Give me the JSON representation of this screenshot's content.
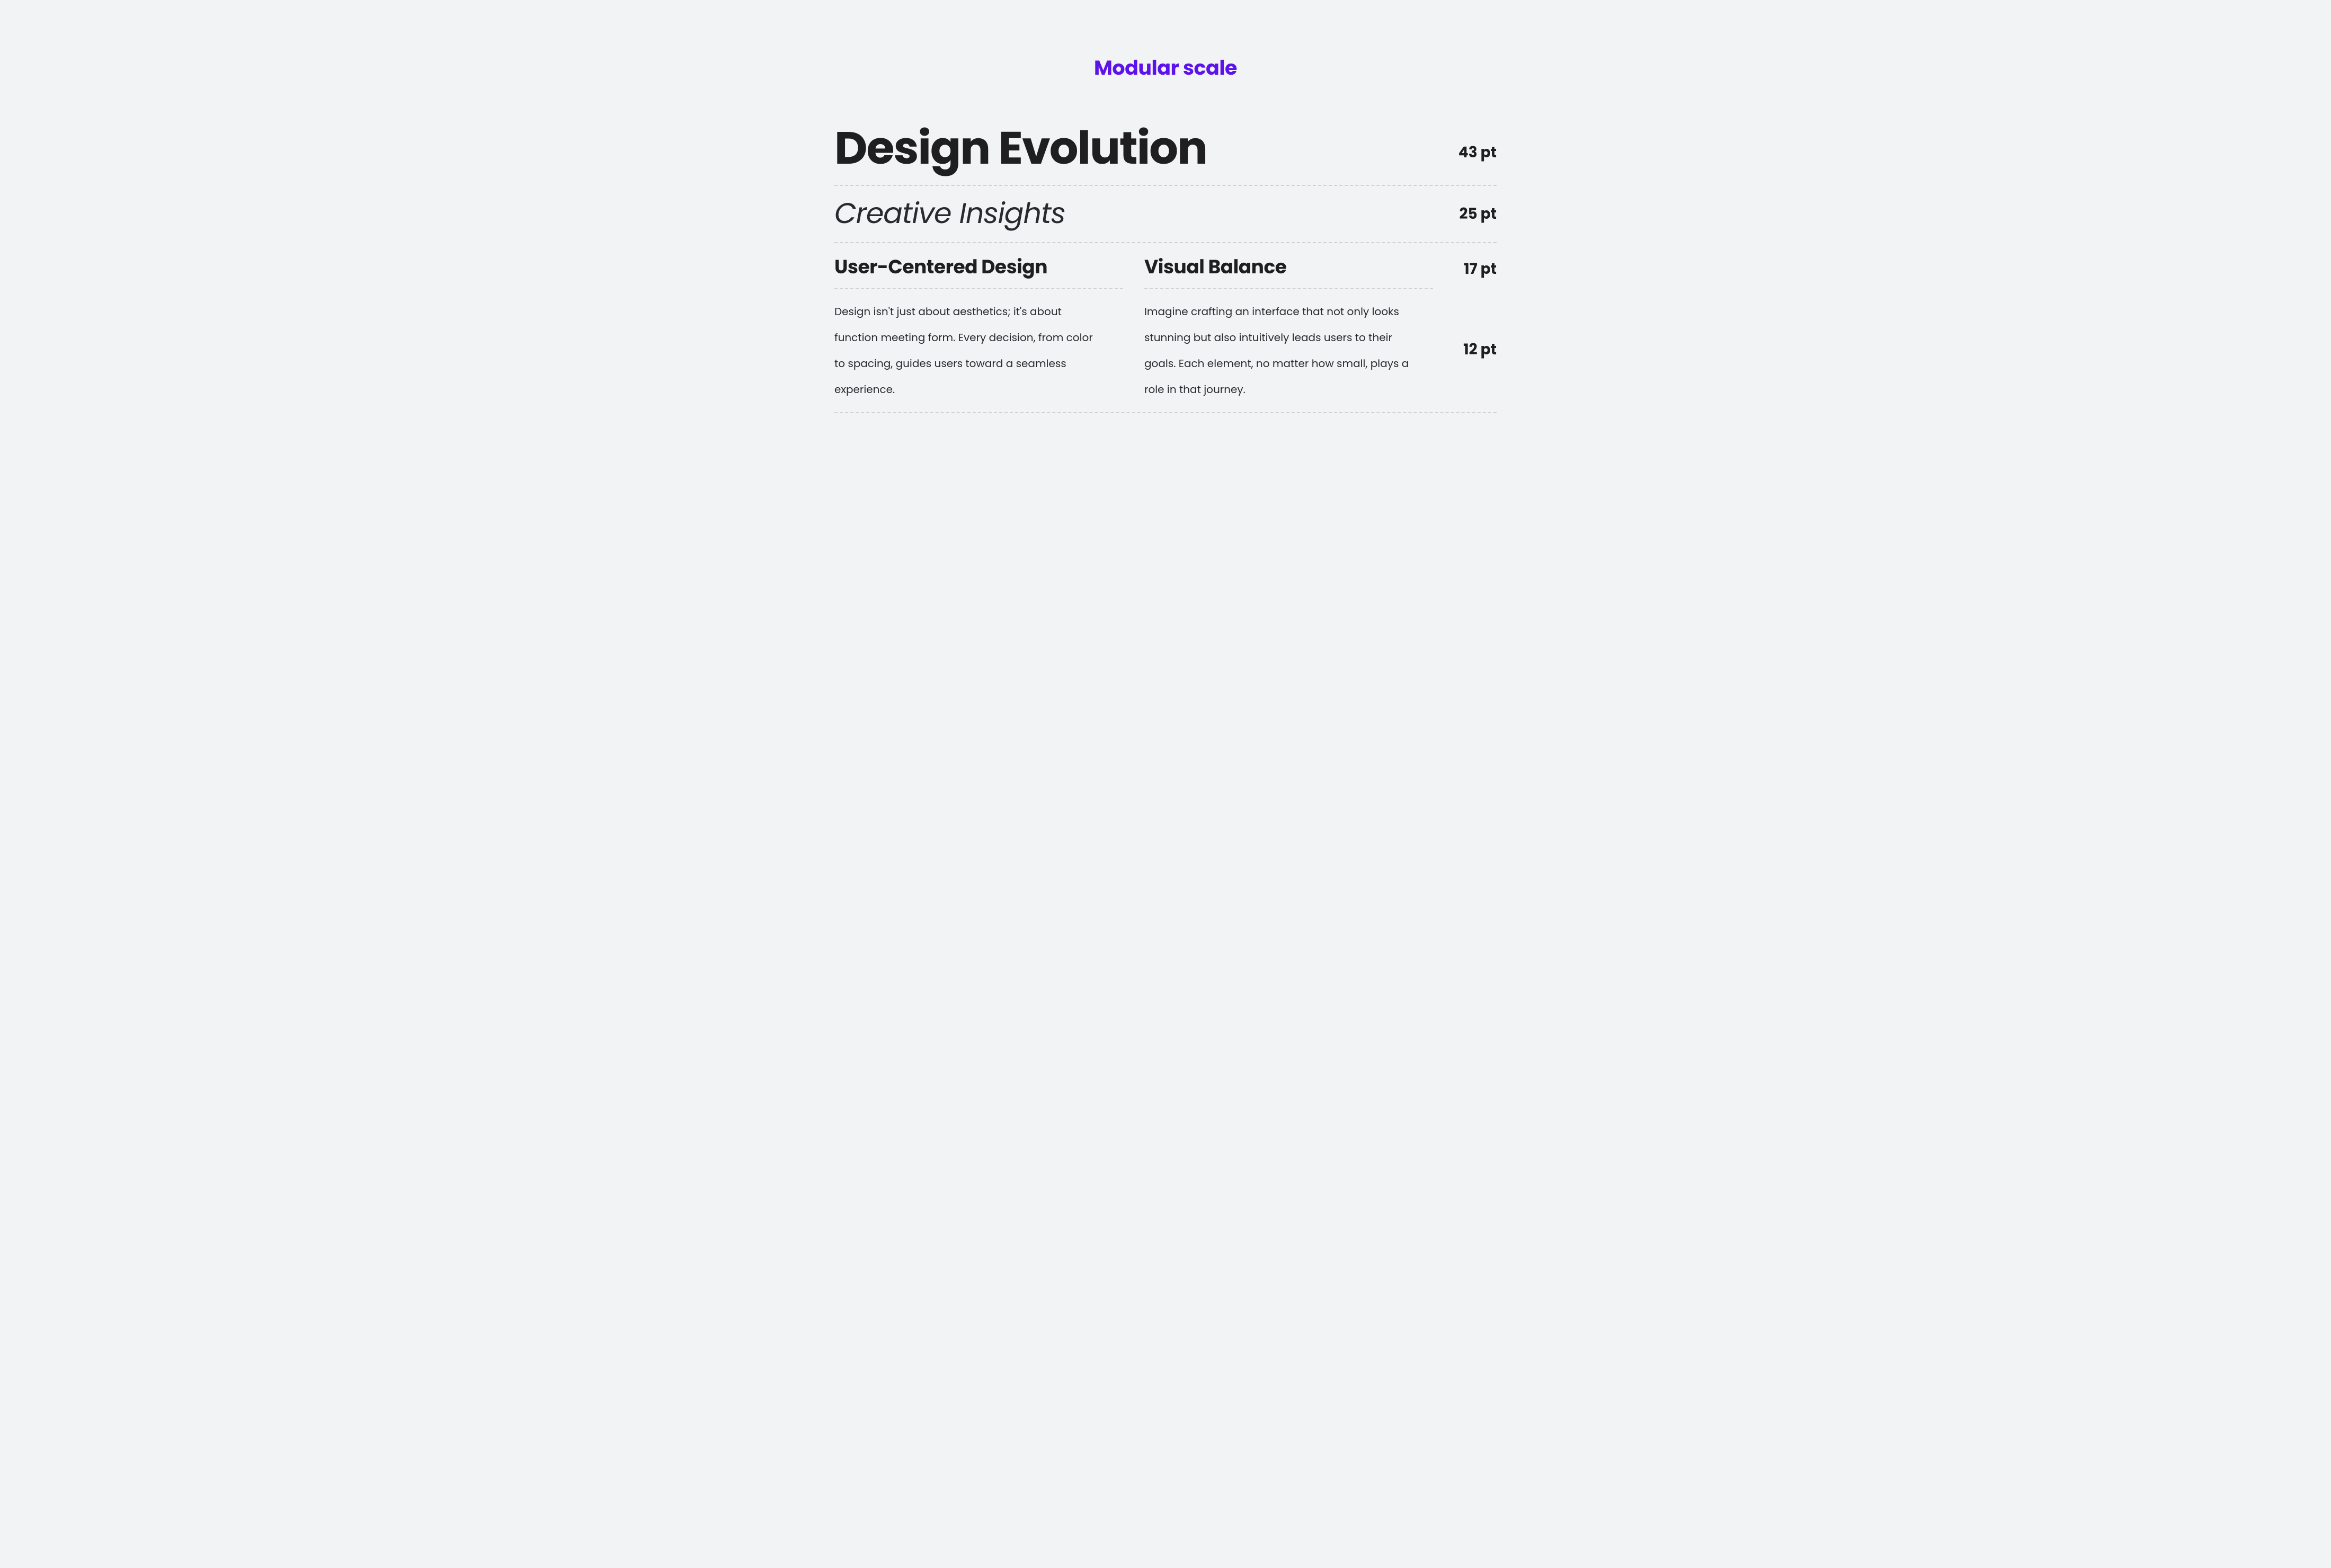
{
  "title": "Modular scale",
  "rows": {
    "h1": {
      "text": "Design Evolution",
      "pt": "43 pt"
    },
    "h2": {
      "text": "Creative Insights",
      "pt": "25 pt"
    },
    "h3": {
      "left": "User-Centered Design",
      "right": "Visual Balance",
      "pt": "17 pt"
    },
    "body": {
      "left": "Design isn't just about aesthetics; it's about function meeting form. Every decision, from color to spacing, guides users toward a seamless experience.",
      "right": "Imagine crafting an interface that not only looks stunning but also intuitively leads users to their goals. Each element, no matter how small, plays a role in that journey.",
      "pt": "12 pt"
    }
  },
  "colors": {
    "accent": "#5c12eb",
    "text": "#1f1f22",
    "bg": "#f2f3f5"
  }
}
